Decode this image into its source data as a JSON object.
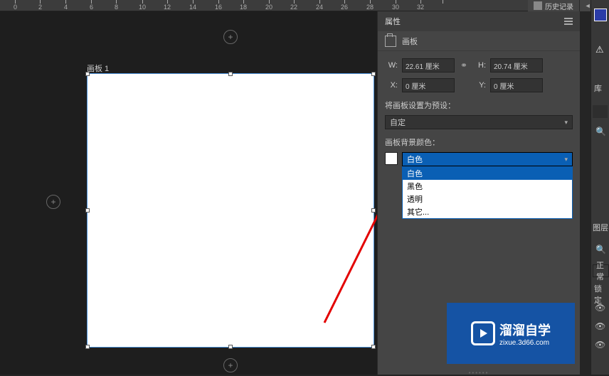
{
  "top_tab": {
    "label": "历史记录"
  },
  "ruler": {
    "ticks": [
      "0",
      "2",
      "4",
      "6",
      "8",
      "10",
      "12",
      "14",
      "16",
      "18",
      "20",
      "22",
      "24",
      "26",
      "28",
      "30",
      "32"
    ]
  },
  "artboard": {
    "label": "画板 1"
  },
  "properties": {
    "title": "属性",
    "context_label": "画板",
    "w_label": "W:",
    "w_value": "22.61 厘米",
    "h_label": "H:",
    "h_value": "20.74 厘米",
    "x_label": "X:",
    "x_value": "0 厘米",
    "y_label": "Y:",
    "y_value": "0 厘米",
    "preset_label": "将画板设置为预设：",
    "preset_value": "自定",
    "bg_label": "画板背景颜色：",
    "bg_selected": "白色",
    "bg_options": [
      "白色",
      "黑色",
      "透明",
      "其它..."
    ]
  },
  "dock": {
    "lib": "库",
    "layers": "图层",
    "normal": "正常",
    "lock": "锁定"
  },
  "watermark": {
    "title": "溜溜自学",
    "url": "zixue.3d66.com"
  }
}
